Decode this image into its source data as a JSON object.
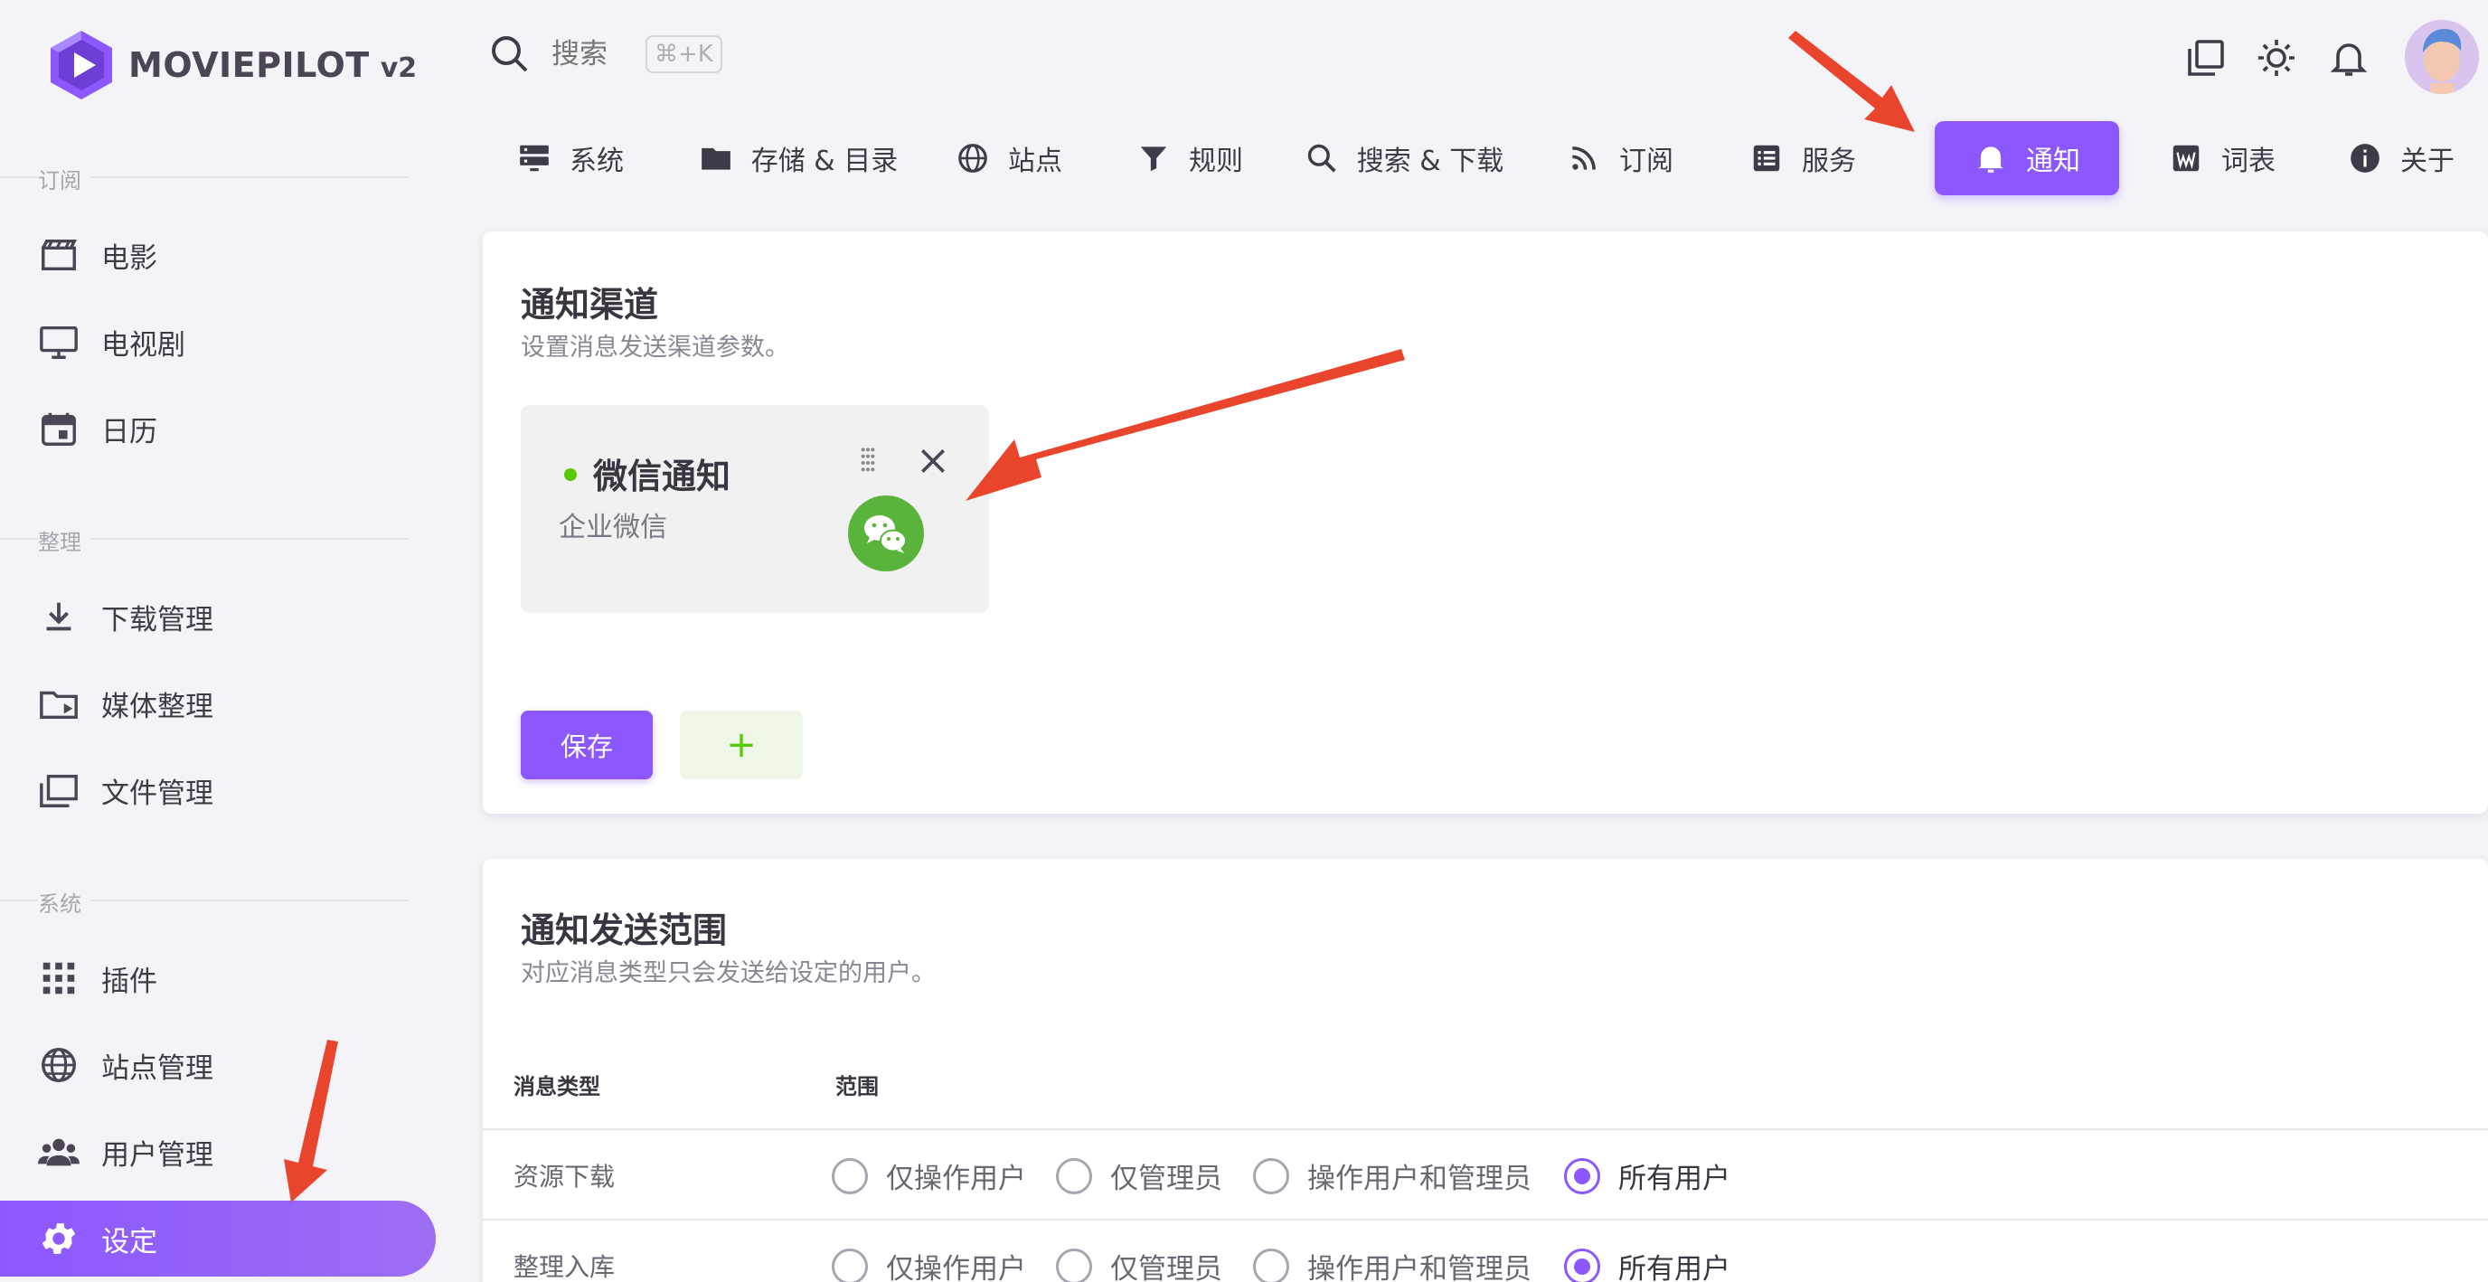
{
  "app": {
    "name": "MOVIEPILOT",
    "version": "v2"
  },
  "search": {
    "placeholder": "搜索",
    "shortcut": "⌘+K"
  },
  "sidebar": {
    "sections": [
      {
        "title": "订阅",
        "items": [
          {
            "label": "电影",
            "icon": "movie-icon"
          },
          {
            "label": "电视剧",
            "icon": "tv-icon"
          },
          {
            "label": "日历",
            "icon": "calendar-icon"
          }
        ]
      },
      {
        "title": "整理",
        "items": [
          {
            "label": "下载管理",
            "icon": "download-icon"
          },
          {
            "label": "媒体整理",
            "icon": "folder-play-icon"
          },
          {
            "label": "文件管理",
            "icon": "files-icon"
          }
        ]
      },
      {
        "title": "系统",
        "items": [
          {
            "label": "插件",
            "icon": "apps-grid-icon"
          },
          {
            "label": "站点管理",
            "icon": "globe-icon"
          },
          {
            "label": "用户管理",
            "icon": "users-icon"
          },
          {
            "label": "设定",
            "icon": "gear-icon",
            "active": true
          }
        ]
      }
    ]
  },
  "tabs": [
    {
      "label": "系统",
      "icon": "server-icon"
    },
    {
      "label": "存储 & 目录",
      "icon": "folder-icon"
    },
    {
      "label": "站点",
      "icon": "globe-icon"
    },
    {
      "label": "规则",
      "icon": "filter-icon"
    },
    {
      "label": "搜索 & 下载",
      "icon": "search-icon"
    },
    {
      "label": "订阅",
      "icon": "rss-icon"
    },
    {
      "label": "服务",
      "icon": "list-icon"
    },
    {
      "label": "通知",
      "icon": "bell-icon",
      "active": true
    },
    {
      "label": "词表",
      "icon": "word-icon"
    },
    {
      "label": "关于",
      "icon": "info-icon"
    }
  ],
  "channels_card": {
    "title": "通知渠道",
    "subtitle": "设置消息发送渠道参数。",
    "channel": {
      "name": "微信通知",
      "type": "企业微信",
      "status_color": "#56ca00",
      "icon": "wechat-icon"
    },
    "save_label": "保存",
    "add_label": "+"
  },
  "scope_card": {
    "title": "通知发送范围",
    "subtitle": "对应消息类型只会发送给设定的用户。",
    "col_type": "消息类型",
    "col_scope": "范围",
    "options": [
      "仅操作用户",
      "仅管理员",
      "操作用户和管理员",
      "所有用户"
    ],
    "rows": [
      {
        "type": "资源下载",
        "selected": 3
      },
      {
        "type": "整理入库",
        "selected": 3
      }
    ]
  },
  "colors": {
    "primary": "#8c57ff",
    "success": "#56ca00",
    "annotation": "#e8452c"
  }
}
